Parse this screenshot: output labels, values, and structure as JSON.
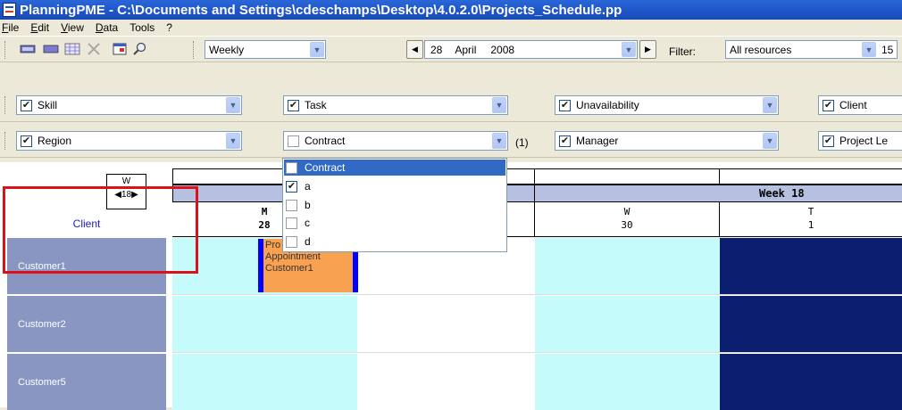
{
  "window": {
    "title": "PlanningPME - C:\\Documents and Settings\\cdeschamps\\Desktop\\4.0.2.0\\Projects_Schedule.pp"
  },
  "menu": [
    "File",
    "Edit",
    "View",
    "Data",
    "Tools",
    "?"
  ],
  "toolbar": {
    "view_mode": "Weekly",
    "date_day": "28",
    "date_month": "April",
    "date_year": "2008",
    "filter_label": "Filter:",
    "filter_value": "All resources",
    "extra_value": "15"
  },
  "filters_row1": [
    {
      "label": "Skill",
      "checked": true
    },
    {
      "label": "Task",
      "checked": true
    },
    {
      "label": "Unavailability",
      "checked": true
    },
    {
      "label": "Client",
      "checked": true
    }
  ],
  "filters_row2": [
    {
      "label": "Region",
      "checked": true
    },
    {
      "label": "Contract",
      "checked": false,
      "count": "(1)"
    },
    {
      "label": "Manager",
      "checked": true
    },
    {
      "label": "Project Le",
      "checked": true
    }
  ],
  "contract_dropdown": [
    {
      "label": "Contract",
      "checked": false,
      "highlighted": true
    },
    {
      "label": "a",
      "checked": true
    },
    {
      "label": "b",
      "checked": false
    },
    {
      "label": "c",
      "checked": false
    },
    {
      "label": "d",
      "checked": false
    }
  ],
  "grid": {
    "corner_nav_top": "W",
    "corner_nav_week": "18",
    "row_header": "Client",
    "week_label": "Week 18",
    "days": [
      {
        "letter": "M",
        "num": "28"
      },
      {
        "letter": "W",
        "num": "30"
      },
      {
        "letter": "T",
        "num": "1"
      }
    ],
    "rows": [
      "Customer1",
      "Customer2",
      "Customer5"
    ],
    "appointment": {
      "line1": "Pro",
      "line2": "Appointment",
      "line3": "Customer1"
    }
  }
}
